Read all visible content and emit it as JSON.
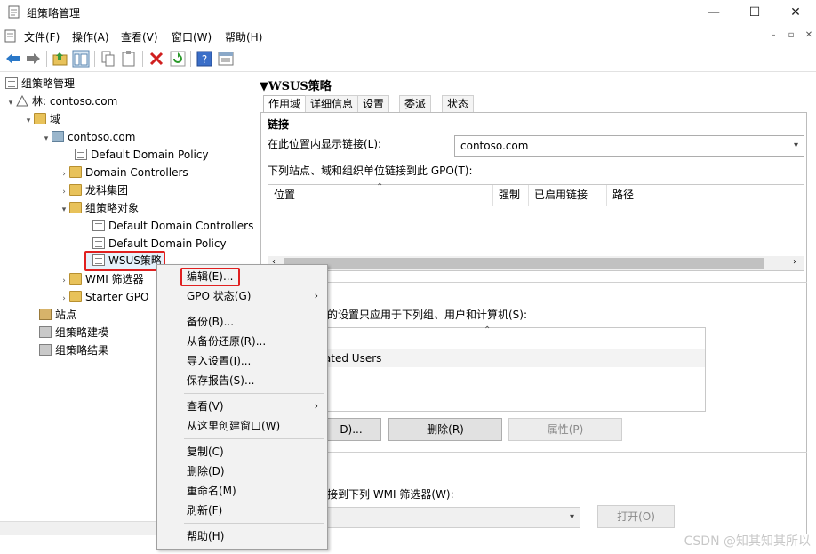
{
  "window": {
    "title": "组策略管理",
    "minimize": "—",
    "maximize": "☐",
    "close": "✕"
  },
  "menubar": {
    "items": [
      "文件(F)",
      "操作(A)",
      "查看(V)",
      "窗口(W)",
      "帮助(H)"
    ],
    "mdi_buttons": [
      "–",
      "▫",
      "✕"
    ]
  },
  "toolbar": {
    "buttons": [
      "back-icon",
      "forward-icon",
      "up-folder-icon",
      "show-tree-icon",
      "copy-icon",
      "paste-icon",
      "delete-icon",
      "refresh-icon",
      "help-icon",
      "properties-icon"
    ]
  },
  "tree": {
    "root": "组策略管理",
    "forest": "林: contoso.com",
    "domains": "域",
    "domain": "contoso.com",
    "items": {
      "ddp": "Default Domain Policy",
      "dc": "Domain Controllers",
      "longke": "龙科集团",
      "gpo_objects": "组策略对象",
      "ddcp": "Default Domain Controllers",
      "ddp2": "Default Domain Policy",
      "wsus": "WSUS策略",
      "wmi": "WMI 筛选器",
      "starter": "Starter GPO",
      "sites": "站点",
      "modeling": "组策略建模",
      "results": "组策略结果"
    }
  },
  "right": {
    "title": "WSUS策略",
    "tabs": [
      "作用域",
      "详细信息",
      "设置",
      "委派",
      "状态"
    ],
    "active_tab": "作用域",
    "links": {
      "heading": "链接",
      "display_label": "在此位置内显示链接(L):",
      "location_value": "contoso.com",
      "list_label": "下列站点、域和组织单位链接到此 GPO(T):",
      "columns": [
        "位置",
        "强制",
        "已启用链接",
        "路径"
      ]
    },
    "security": {
      "label_partial": "的设置只应用于下列组、用户和计算机(S):",
      "item_partial": "icated Users",
      "add_partial": "D)...",
      "remove": "删除(R)",
      "props": "属性(P)"
    },
    "wmi": {
      "label_partial": "接到下列 WMI 筛选器(W):",
      "open": "打开(O)"
    }
  },
  "context_menu": {
    "items": {
      "edit": "编辑(E)...",
      "gpo_status": "GPO 状态(G)",
      "backup": "备份(B)...",
      "restore": "从备份还原(R)...",
      "import": "导入设置(I)...",
      "save_report": "保存报告(S)...",
      "view": "查看(V)",
      "new_window": "从这里创建窗口(W)",
      "copy": "复制(C)",
      "delete": "删除(D)",
      "rename": "重命名(M)",
      "refresh": "刷新(F)",
      "help": "帮助(H)"
    },
    "submenu_arrow": "›"
  },
  "watermark": "CSDN @知其知其所以"
}
